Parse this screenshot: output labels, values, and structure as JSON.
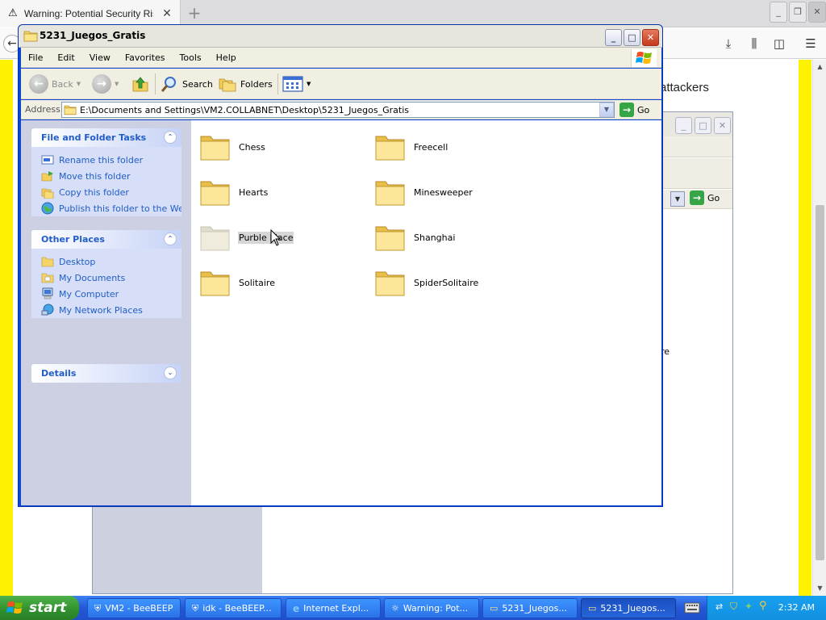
{
  "browser": {
    "tab_title": "Warning: Potential Security Risk Ahead",
    "visible_text": "attackers",
    "window_buttons": {
      "minimize": "_",
      "restore": "❐",
      "close": "✕"
    }
  },
  "bg_window": {
    "go_label": "Go",
    "fragment_text": "re"
  },
  "explorer": {
    "title": "5231_Juegos_Gratis",
    "menu": [
      "File",
      "Edit",
      "View",
      "Favorites",
      "Tools",
      "Help"
    ],
    "toolbar": {
      "back": "Back",
      "search": "Search",
      "folders": "Folders"
    },
    "address": {
      "label": "Address",
      "path": "E:\\Documents and Settings\\VM2.COLLABNET\\Desktop\\5231_Juegos_Gratis",
      "go": "Go"
    },
    "tasks_panel": {
      "title": "File and Folder Tasks",
      "items": [
        "Rename this folder",
        "Move this folder",
        "Copy this folder",
        "Publish this folder to the Web"
      ]
    },
    "places_panel": {
      "title": "Other Places",
      "items": [
        "Desktop",
        "My Documents",
        "My Computer",
        "My Network Places"
      ]
    },
    "details_panel": {
      "title": "Details"
    },
    "folders": [
      "Chess",
      "Freecell",
      "Hearts",
      "Minesweeper",
      "Purble Place",
      "Shanghai",
      "Solitaire",
      "SpiderSolitaire"
    ],
    "selected_folder": "Purble Place"
  },
  "taskbar": {
    "start_label": "start",
    "items": [
      "VM2 - BeeBEEP",
      "idk - BeeBEEP...",
      "Internet Expl...",
      "Warning: Pot...",
      "5231_Juegos...",
      "5231_Juegos..."
    ],
    "active_index": 5,
    "clock": "2:32 AM"
  },
  "colors": {
    "xp_blue": "#0a46d8",
    "taskbar_blue": "#2458d6",
    "start_green": "#2f8f2d",
    "link_blue": "#215dc6",
    "warning_yellow": "#fff200"
  }
}
